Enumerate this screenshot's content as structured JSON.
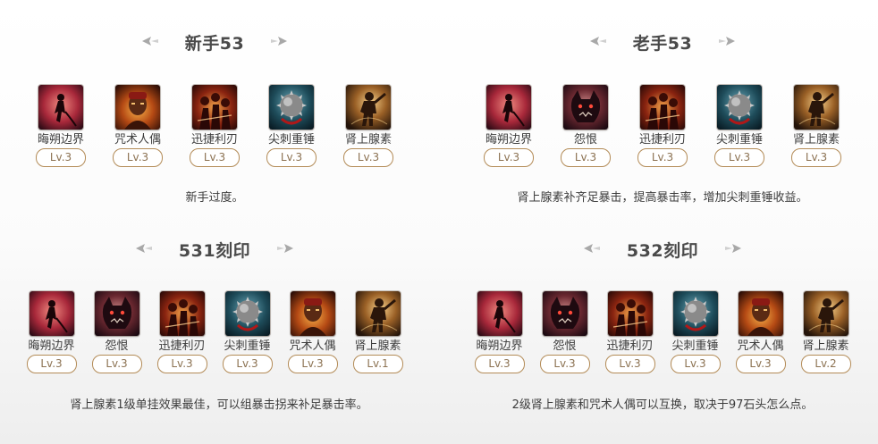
{
  "builds": [
    {
      "title": "新手53",
      "skills": [
        {
          "name": "晦朔边界",
          "level": "Lv.3",
          "icon": "witch-moon-icon"
        },
        {
          "name": "咒术人偶",
          "level": "Lv.3",
          "icon": "hex-doll-icon"
        },
        {
          "name": "迅捷利刃",
          "level": "Lv.3",
          "icon": "swift-blade-icon"
        },
        {
          "name": "尖刺重锤",
          "level": "Lv.3",
          "icon": "spiked-hammer-icon"
        },
        {
          "name": "肾上腺素",
          "level": "Lv.3",
          "icon": "adrenaline-icon"
        }
      ],
      "note": "新手过度。"
    },
    {
      "title": "老手53",
      "skills": [
        {
          "name": "晦朔边界",
          "level": "Lv.3",
          "icon": "witch-moon-icon"
        },
        {
          "name": "怨恨",
          "level": "Lv.3",
          "icon": "resentment-icon"
        },
        {
          "name": "迅捷利刃",
          "level": "Lv.3",
          "icon": "swift-blade-icon"
        },
        {
          "name": "尖刺重锤",
          "level": "Lv.3",
          "icon": "spiked-hammer-icon"
        },
        {
          "name": "肾上腺素",
          "level": "Lv.3",
          "icon": "adrenaline-icon"
        }
      ],
      "note": "肾上腺素补齐足暴击，提高暴击率，增加尖刺重锤收益。"
    },
    {
      "title": "531刻印",
      "skills": [
        {
          "name": "晦朔边界",
          "level": "Lv.3",
          "icon": "witch-moon-icon"
        },
        {
          "name": "怨恨",
          "level": "Lv.3",
          "icon": "resentment-icon"
        },
        {
          "name": "迅捷利刃",
          "level": "Lv.3",
          "icon": "swift-blade-icon"
        },
        {
          "name": "尖刺重锤",
          "level": "Lv.3",
          "icon": "spiked-hammer-icon"
        },
        {
          "name": "咒术人偶",
          "level": "Lv.3",
          "icon": "hex-doll-icon"
        },
        {
          "name": "肾上腺素",
          "level": "Lv.1",
          "icon": "adrenaline-icon"
        }
      ],
      "note": "肾上腺素1级单挂效果最佳，可以组暴击拐来补足暴击率。"
    },
    {
      "title": "532刻印",
      "skills": [
        {
          "name": "晦朔边界",
          "level": "Lv.3",
          "icon": "witch-moon-icon"
        },
        {
          "name": "怨恨",
          "level": "Lv.3",
          "icon": "resentment-icon"
        },
        {
          "name": "迅捷利刃",
          "level": "Lv.3",
          "icon": "swift-blade-icon"
        },
        {
          "name": "尖刺重锤",
          "level": "Lv.3",
          "icon": "spiked-hammer-icon"
        },
        {
          "name": "咒术人偶",
          "level": "Lv.3",
          "icon": "hex-doll-icon"
        },
        {
          "name": "肾上腺素",
          "level": "Lv.2",
          "icon": "adrenaline-icon"
        }
      ],
      "note": "2级肾上腺素和咒术人偶可以互换，取决于97石头怎么点。"
    }
  ],
  "colors": {
    "title": "#4a4a4a",
    "pill_border": "#b38b57",
    "pill_text": "#8c7252",
    "text": "#3c3c3c"
  }
}
